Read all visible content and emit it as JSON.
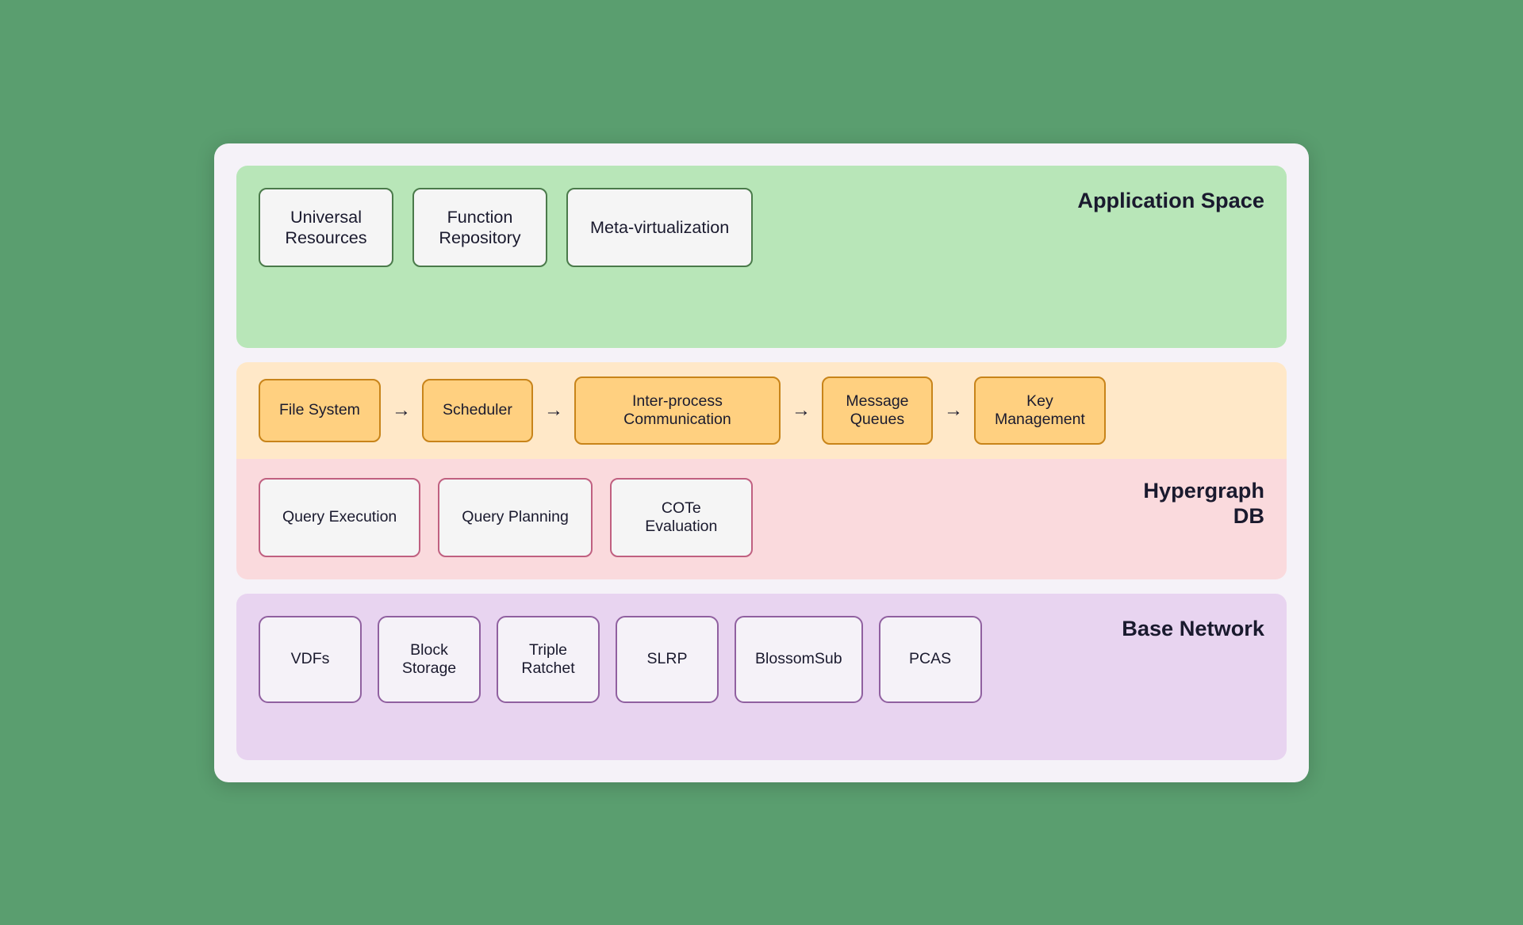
{
  "appSpace": {
    "label": "Application Space",
    "boxes": [
      {
        "id": "universal-resources",
        "text": "Universal\nResources"
      },
      {
        "id": "function-repository",
        "text": "Function\nRepository"
      },
      {
        "id": "meta-virtualization",
        "text": "Meta-virtualization"
      }
    ]
  },
  "kernel": {
    "items": [
      {
        "id": "file-system",
        "text": "File System",
        "wide": false
      },
      {
        "id": "scheduler",
        "text": "Scheduler",
        "wide": false
      },
      {
        "id": "ipc",
        "text": "Inter-process\nCommunication",
        "wide": true
      },
      {
        "id": "message-queues",
        "text": "Message\nQueues",
        "wide": false
      },
      {
        "id": "key-management",
        "text": "Key\nManagement",
        "wide": false
      }
    ]
  },
  "hypergraph": {
    "label": "Hypergraph\nDB",
    "boxes": [
      {
        "id": "query-execution",
        "text": "Query Execution"
      },
      {
        "id": "query-planning",
        "text": "Query Planning"
      },
      {
        "id": "cote-evaluation",
        "text": "COTe\nEvaluation"
      }
    ]
  },
  "baseNetwork": {
    "label": "Base Network",
    "boxes": [
      {
        "id": "vdfs",
        "text": "VDFs"
      },
      {
        "id": "block-storage",
        "text": "Block\nStorage"
      },
      {
        "id": "triple-ratchet",
        "text": "Triple\nRatchet"
      },
      {
        "id": "slrp",
        "text": "SLRP"
      },
      {
        "id": "blossomsub",
        "text": "BlossomSub"
      },
      {
        "id": "pcas",
        "text": "PCAS"
      }
    ]
  },
  "arrows": {
    "symbol": "→"
  }
}
